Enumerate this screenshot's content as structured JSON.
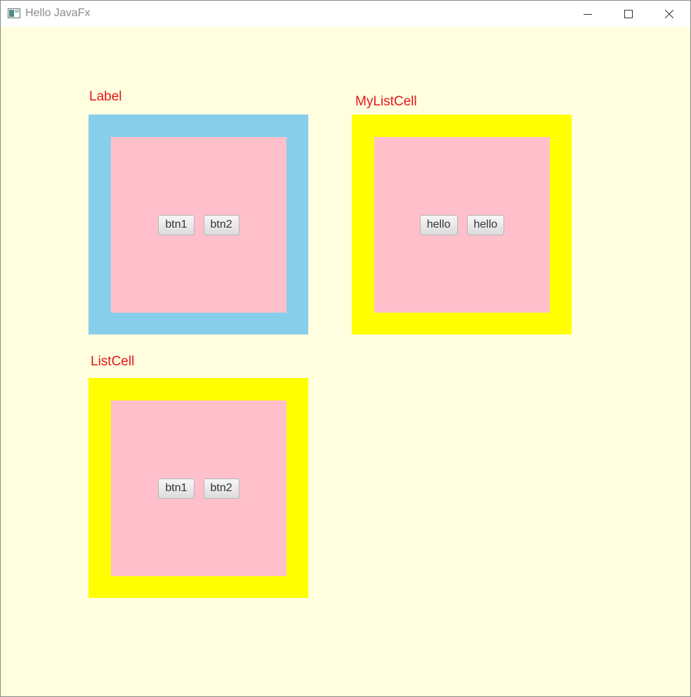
{
  "window": {
    "title": "Hello JavaFx",
    "controls": [
      "minimize-icon",
      "maximize-icon",
      "close-icon"
    ]
  },
  "colors": {
    "scene_background": "#fffedf",
    "label_text": "#e3171b",
    "blue_border": "#87ceeb",
    "yellow_border": "#ffff00",
    "pink_fill": "#ffc0cb"
  },
  "sections": [
    {
      "label": "Label",
      "border_color": "#87ceeb",
      "buttons": [
        "btn1",
        "btn2"
      ]
    },
    {
      "label": "MyListCell",
      "border_color": "#ffff00",
      "buttons": [
        "hello",
        "hello"
      ]
    },
    {
      "label": "ListCell",
      "border_color": "#ffff00",
      "buttons": [
        "btn1",
        "btn2"
      ]
    }
  ]
}
